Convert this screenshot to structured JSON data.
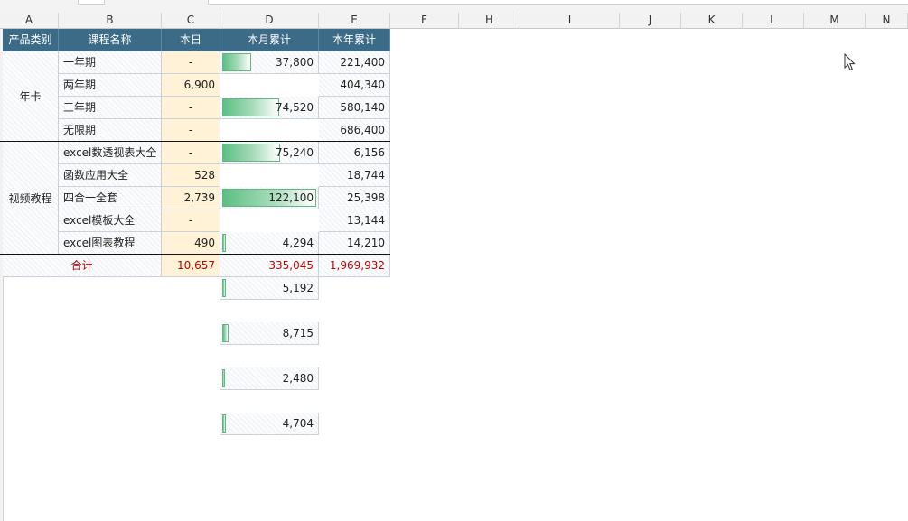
{
  "columns": [
    "A",
    "B",
    "C",
    "D",
    "E",
    "F",
    "H",
    "I",
    "J",
    "K",
    "L",
    "M",
    "N"
  ],
  "header": {
    "category": "产品类别",
    "course": "课程名称",
    "today": "本日",
    "month_total": "本月累计",
    "year_total": "本年累计"
  },
  "groups": [
    {
      "name": "年卡"
    },
    {
      "name": "视频教程"
    }
  ],
  "rows": [
    {
      "course": "一年期",
      "today": "-",
      "month": "37,800",
      "month_value": 37800,
      "year": "221,400"
    },
    {
      "course": "两年期",
      "today": "6,900",
      "month": "74,520",
      "month_value": 74520,
      "year": "404,340"
    },
    {
      "course": "三年期",
      "today": "-",
      "month": "75,240",
      "month_value": 75240,
      "year": "580,140"
    },
    {
      "course": "无限期",
      "today": "-",
      "month": "122,100",
      "month_value": 122100,
      "year": "686,400"
    },
    {
      "course": "excel数透视表大全",
      "today": "-",
      "month": "4,294",
      "month_value": 4294,
      "year": "6,156"
    },
    {
      "course": "函数应用大全",
      "today": "528",
      "month": "5,192",
      "month_value": 5192,
      "year": "18,744"
    },
    {
      "course": "四合一全套",
      "today": "2,739",
      "month": "8,715",
      "month_value": 8715,
      "year": "25,398"
    },
    {
      "course": "excel模板大全",
      "today": "-",
      "month": "2,480",
      "month_value": 2480,
      "year": "13,144"
    },
    {
      "course": "excel图表教程",
      "today": "490",
      "month": "4,704",
      "month_value": 4704,
      "year": "14,210"
    }
  ],
  "total": {
    "label": "合计",
    "today": "10,657",
    "month": "335,045",
    "year": "1,969,932"
  },
  "colors": {
    "header_bg": "#3b6b86",
    "today_bg": "#fff2d6",
    "bar": "#5cbf84",
    "total_text": "#c00000"
  }
}
